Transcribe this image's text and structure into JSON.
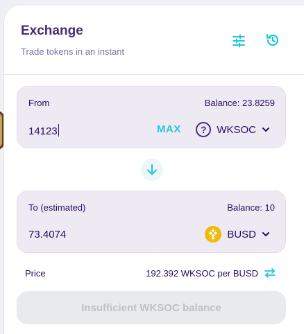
{
  "header": {
    "title": "Exchange",
    "subtitle": "Trade tokens in an instant",
    "settings_icon": "settings-sliders-icon",
    "history_icon": "history-icon"
  },
  "from_panel": {
    "label": "From",
    "balance": "Balance: 23.8259",
    "amount": "14123",
    "max_label": "MAX",
    "token_symbol": "WKSOC",
    "token_icon": "question-mark-icon"
  },
  "switch": {
    "icon": "arrow-down-icon"
  },
  "to_panel": {
    "label": "To (estimated)",
    "balance": "Balance: 10",
    "amount": "73.4074",
    "token_symbol": "BUSD",
    "token_icon": "busd-coin-icon"
  },
  "price": {
    "label": "Price",
    "value": "192.392 WKSOC per BUSD",
    "switch_icon": "swap-arrows-icon"
  },
  "action_button": {
    "label": "Insufficient WKSOC balance",
    "disabled": true
  },
  "colors": {
    "accent": "#1fc7d4",
    "title": "#452a7a",
    "text": "#280d5f",
    "panel_bg": "#eeeaf4",
    "busd": "#f0b90b"
  }
}
